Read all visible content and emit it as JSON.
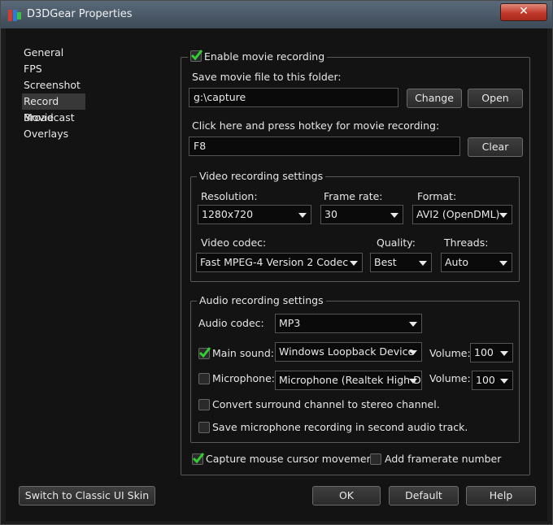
{
  "window": {
    "title": "D3DGear Properties",
    "close_label": "✕"
  },
  "nav": {
    "items": [
      {
        "label": "General"
      },
      {
        "label": "FPS"
      },
      {
        "label": "Screenshot"
      },
      {
        "label": "Record Movie"
      },
      {
        "label": "Broadcast"
      },
      {
        "label": "Overlays"
      }
    ],
    "selected": "Record Movie"
  },
  "record": {
    "enable_label": "Enable movie recording",
    "enable_checked": true,
    "save_folder_label": "Save movie file to this folder:",
    "save_folder_value": "g:\\capture",
    "change_label": "Change",
    "open_label": "Open",
    "hotkey_label": "Click here and press hotkey for movie recording:",
    "hotkey_value": "F8",
    "clear_label": "Clear"
  },
  "video": {
    "group_label": "Video recording settings",
    "resolution_label": "Resolution:",
    "resolution_value": "1280x720",
    "framerate_label": "Frame rate:",
    "framerate_value": "30",
    "format_label": "Format:",
    "format_value": "AVI2 (OpenDML)",
    "codec_label": "Video codec:",
    "codec_value": "Fast MPEG-4 Version 2 Codec",
    "quality_label": "Quality:",
    "quality_value": "Best",
    "threads_label": "Threads:",
    "threads_value": "Auto"
  },
  "audio": {
    "group_label": "Audio recording settings",
    "codec_label": "Audio codec:",
    "codec_value": "MP3",
    "main_sound_label": "Main sound:",
    "main_sound_checked": true,
    "main_sound_device": "Windows Loopback Device",
    "volume_label": "Volume:",
    "main_volume": "100",
    "microphone_label": "Microphone:",
    "microphone_checked": false,
    "microphone_device": "Microphone (Realtek High D",
    "mic_volume": "100",
    "convert_label": "Convert surround channel to stereo channel.",
    "convert_checked": false,
    "save_mic_label": "Save microphone recording in second audio track.",
    "save_mic_checked": false
  },
  "options": {
    "capture_mouse_label": "Capture mouse cursor movement",
    "capture_mouse_checked": true,
    "framerate_number_label": "Add framerate number",
    "framerate_number_checked": false
  },
  "footer": {
    "classic_skin_label": "Switch to Classic UI Skin",
    "ok_label": "OK",
    "default_label": "Default",
    "help_label": "Help"
  },
  "colors": {
    "check_green": "#33cc33",
    "close_red": "#c0392b"
  }
}
